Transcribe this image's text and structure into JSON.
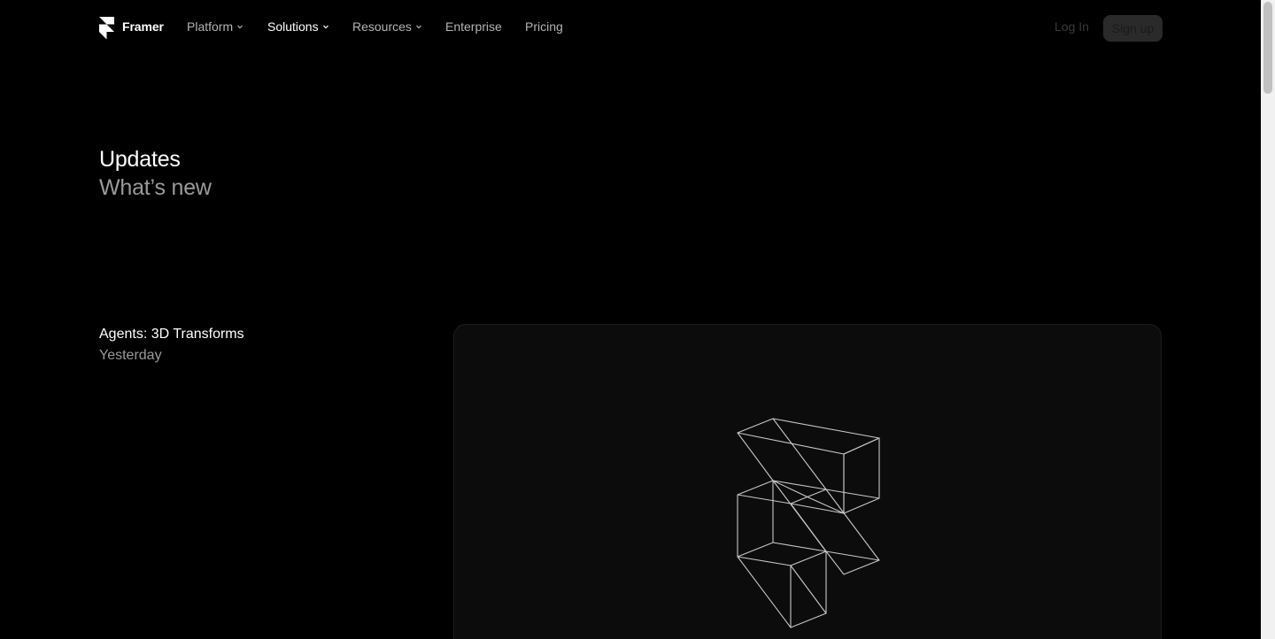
{
  "nav": {
    "brand": "Framer",
    "items": [
      {
        "label": "Platform",
        "dropdown": true,
        "active": false
      },
      {
        "label": "Solutions",
        "dropdown": true,
        "active": true
      },
      {
        "label": "Resources",
        "dropdown": true,
        "active": false
      },
      {
        "label": "Enterprise",
        "dropdown": false,
        "active": false
      },
      {
        "label": "Pricing",
        "dropdown": false,
        "active": false
      }
    ],
    "login_label": "Log In",
    "signup_label": "Sign up"
  },
  "hero": {
    "title": "Updates",
    "subtitle": "What’s new"
  },
  "post": {
    "title": "Agents: 3D Transforms",
    "date": "Yesterday",
    "image_icon": "framer-logo-wireframe-icon"
  },
  "colors": {
    "background": "#000000",
    "text_primary": "#ffffff",
    "text_secondary": "#9a9a9a",
    "card_background": "#0c0c0c"
  }
}
